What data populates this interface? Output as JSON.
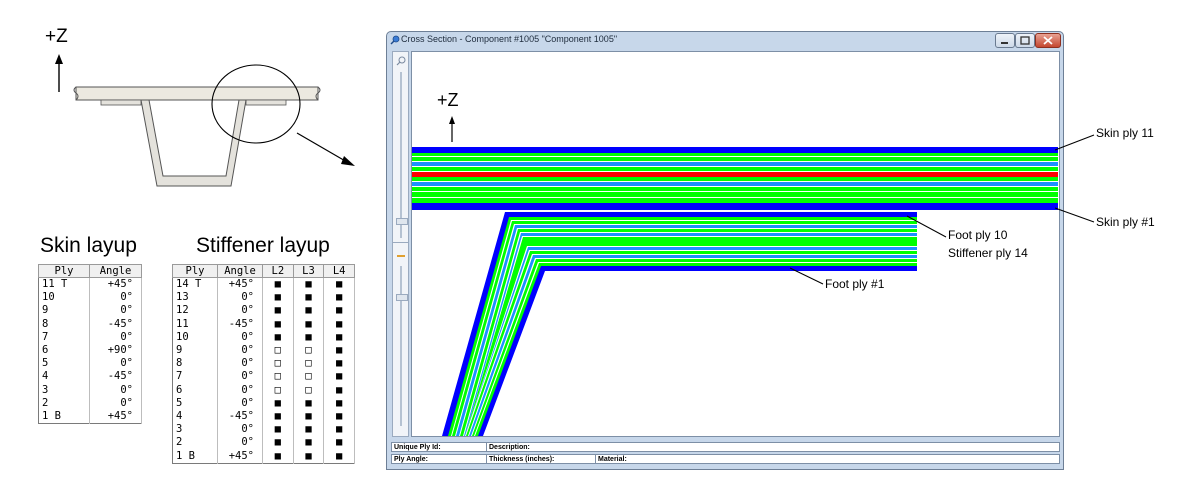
{
  "axis_label_left": "+Z",
  "axis_label_window": "+Z",
  "skin_layup": {
    "title": "Skin layup",
    "headers": [
      "Ply",
      "Angle"
    ],
    "rows": [
      [
        "11 T",
        "+45°"
      ],
      [
        "10",
        "0°"
      ],
      [
        "9",
        "0°"
      ],
      [
        "8",
        "-45°"
      ],
      [
        "7",
        "0°"
      ],
      [
        "6",
        "+90°"
      ],
      [
        "5",
        "0°"
      ],
      [
        "4",
        "-45°"
      ],
      [
        "3",
        "0°"
      ],
      [
        "2",
        "0°"
      ],
      [
        "1 B",
        "+45°"
      ]
    ]
  },
  "stiffener_layup": {
    "title": "Stiffener layup",
    "headers": [
      "Ply",
      "Angle",
      "L2",
      "L3",
      "L4"
    ],
    "rows": [
      [
        "14 T",
        "+45°",
        "■",
        "■",
        "■"
      ],
      [
        "13",
        "0°",
        "■",
        "■",
        "■"
      ],
      [
        "12",
        "0°",
        "■",
        "■",
        "■"
      ],
      [
        "11",
        "-45°",
        "■",
        "■",
        "■"
      ],
      [
        "10",
        "0°",
        "■",
        "■",
        "■"
      ],
      [
        "9",
        "0°",
        "□",
        "□",
        "■"
      ],
      [
        "8",
        "0°",
        "□",
        "□",
        "■"
      ],
      [
        "7",
        "0°",
        "□",
        "□",
        "■"
      ],
      [
        "6",
        "0°",
        "□",
        "□",
        "■"
      ],
      [
        "5",
        "0°",
        "■",
        "■",
        "■"
      ],
      [
        "4",
        "-45°",
        "■",
        "■",
        "■"
      ],
      [
        "3",
        "0°",
        "■",
        "■",
        "■"
      ],
      [
        "2",
        "0°",
        "■",
        "■",
        "■"
      ],
      [
        "1 B",
        "+45°",
        "■",
        "■",
        "■"
      ]
    ]
  },
  "window": {
    "title": "Cross Section - Component #1005 \"Component 1005\"",
    "status": {
      "unique_ply_id": "Unique Ply Id:",
      "description": "Description:",
      "ply_angle": "Ply Angle:",
      "thickness": "Thickness (inches):",
      "material": "Material:"
    }
  },
  "callouts": {
    "skin_top": "Skin ply 11",
    "skin_bottom": "Skin ply #1",
    "foot_top_line1": "Foot ply 10",
    "foot_top_line2": "Stiffener ply 14",
    "foot_bottom": "Foot ply #1"
  },
  "colors": {
    "blue_ply": "#0000ff",
    "green_ply": "#00ff00",
    "red_ply": "#ff0000",
    "light_blue_ply": "#1e90ff"
  }
}
